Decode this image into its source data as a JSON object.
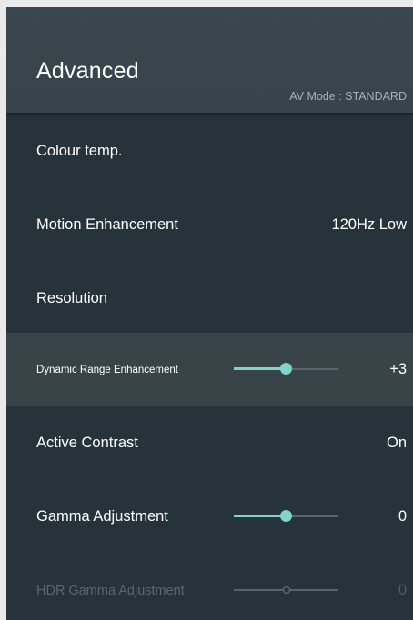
{
  "header": {
    "title": "Advanced",
    "av_mode": "AV Mode : STANDARD"
  },
  "items": [
    {
      "label": "Colour temp.",
      "value": ""
    },
    {
      "label": "Motion Enhancement",
      "value": "120Hz Low"
    },
    {
      "label": "Resolution",
      "value": ""
    },
    {
      "label": "Dynamic Range Enhancement",
      "value": "+3",
      "slider_level": 0.5,
      "selected": true
    },
    {
      "label": "Active Contrast",
      "value": "On"
    },
    {
      "label": "Gamma Adjustment",
      "value": "0",
      "slider_level": 0.5
    },
    {
      "label": "HDR Gamma Adjustment",
      "value": "0",
      "slider_level": 0.5,
      "disabled": true
    }
  ],
  "colors": {
    "panel_bg": "#26333a",
    "header_bg": "#3a474e",
    "highlight_bg": "#394449",
    "accent": "#7fd4cb",
    "disabled_text": "#5a676d"
  }
}
